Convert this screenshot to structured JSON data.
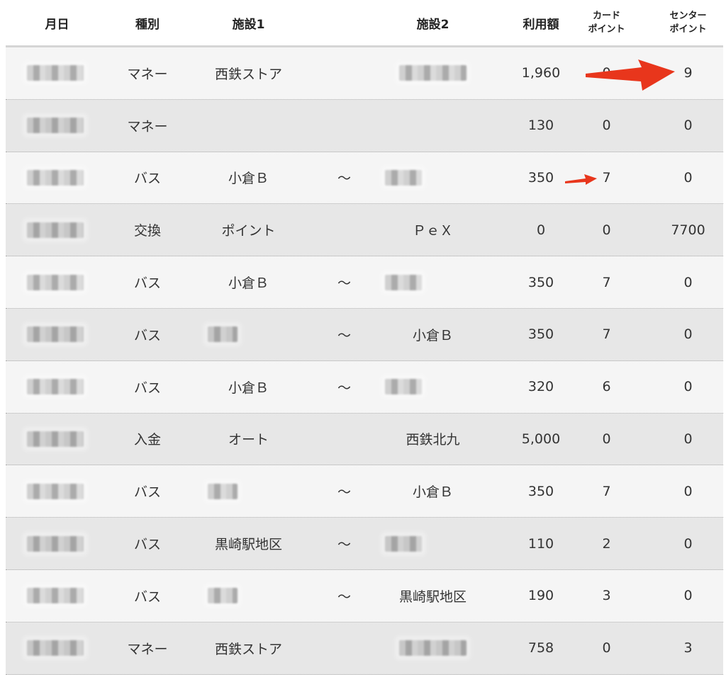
{
  "columns": {
    "date": "月日",
    "type": "種別",
    "facility1": "施設1",
    "facility2": "施設2",
    "amount": "利用額",
    "card_points_line1": "カード",
    "card_points_line2": "ポイント",
    "center_points_line1": "センター",
    "center_points_line2": "ポイント"
  },
  "rows": [
    {
      "type": "マネー",
      "facility1": "西鉄ストア",
      "facility1_blurred": false,
      "tilde": "",
      "facility2": "",
      "facility2_blurred": true,
      "amount": "1,960",
      "card": "0",
      "center": "9"
    },
    {
      "type": "マネー",
      "facility1": "",
      "facility1_blurred": false,
      "tilde": "",
      "facility2": "",
      "facility2_blurred": false,
      "amount": "130",
      "card": "0",
      "center": "0"
    },
    {
      "type": "バス",
      "facility1": "小倉Ｂ",
      "facility1_blurred": false,
      "tilde": "～",
      "facility2": "",
      "facility2_blurred": true,
      "amount": "350",
      "card": "7",
      "center": "0"
    },
    {
      "type": "交換",
      "facility1": "ポイント",
      "facility1_blurred": false,
      "tilde": "",
      "facility2": "ＰｅＸ",
      "facility2_blurred": false,
      "amount": "0",
      "card": "0",
      "center": "7700"
    },
    {
      "type": "バス",
      "facility1": "小倉Ｂ",
      "facility1_blurred": false,
      "tilde": "～",
      "facility2": "",
      "facility2_blurred": true,
      "amount": "350",
      "card": "7",
      "center": "0"
    },
    {
      "type": "バス",
      "facility1": "",
      "facility1_blurred": true,
      "tilde": "～",
      "facility2": "小倉Ｂ",
      "facility2_blurred": false,
      "amount": "350",
      "card": "7",
      "center": "0"
    },
    {
      "type": "バス",
      "facility1": "小倉Ｂ",
      "facility1_blurred": false,
      "tilde": "～",
      "facility2": "",
      "facility2_blurred": true,
      "amount": "320",
      "card": "6",
      "center": "0"
    },
    {
      "type": "入金",
      "facility1": "オート",
      "facility1_blurred": false,
      "tilde": "",
      "facility2": "西鉄北九",
      "facility2_blurred": false,
      "amount": "5,000",
      "card": "0",
      "center": "0"
    },
    {
      "type": "バス",
      "facility1": "",
      "facility1_blurred": true,
      "tilde": "～",
      "facility2": "小倉Ｂ",
      "facility2_blurred": false,
      "amount": "350",
      "card": "7",
      "center": "0"
    },
    {
      "type": "バス",
      "facility1": "黒崎駅地区",
      "facility1_blurred": false,
      "tilde": "～",
      "facility2": "",
      "facility2_blurred": true,
      "amount": "110",
      "card": "2",
      "center": "0"
    },
    {
      "type": "バス",
      "facility1": "",
      "facility1_blurred": true,
      "tilde": "～",
      "facility2": "黒崎駅地区",
      "facility2_blurred": false,
      "amount": "190",
      "card": "3",
      "center": "0"
    },
    {
      "type": "マネー",
      "facility1": "西鉄ストア",
      "facility1_blurred": false,
      "tilde": "",
      "facility2": "",
      "facility2_blurred": true,
      "amount": "758",
      "card": "0",
      "center": "3"
    }
  ],
  "annotations": {
    "arrow_color": "#e8361c"
  }
}
